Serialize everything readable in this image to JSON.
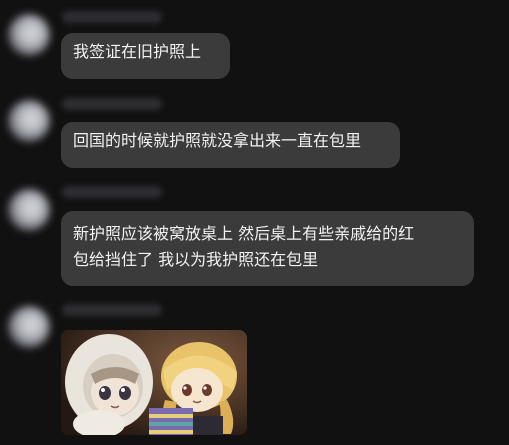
{
  "chat": {
    "messages": [
      {
        "text": "我签证在旧护照上"
      },
      {
        "text": "回国的时候就护照就没拿出来一直在包里"
      },
      {
        "text": "新护照应该被窝放桌上 然后桌上有些亲戚给的红\n包给挡住了 我以为我护照还在包里"
      }
    ],
    "photo": {
      "description_icon": "plush-dolls-photo"
    }
  },
  "colors": {
    "background": "#111111",
    "bubble": "#3b3b3b",
    "text": "#f2f2f2"
  }
}
